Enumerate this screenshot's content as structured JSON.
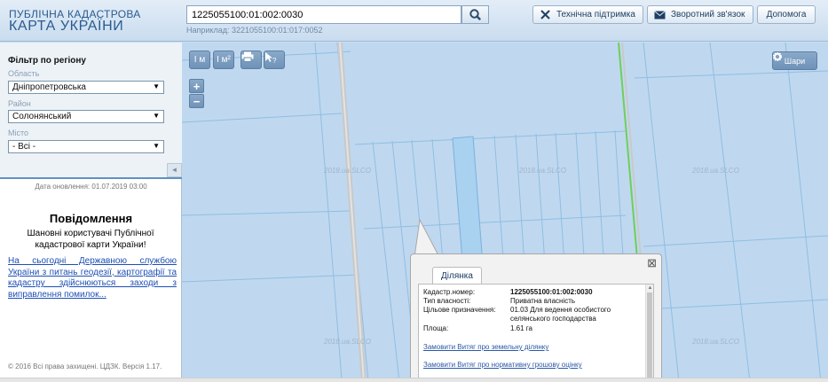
{
  "header": {
    "logo_line1": "ПУБЛІЧНА КАДАСТРОВА",
    "logo_line2": "КАРТА УКРАЇНИ",
    "search_value": "1225055100:01:002:0030",
    "search_hint": "Наприклад: 3221055100:01:017:0052",
    "search_icon": "search-icon",
    "buttons": {
      "support": "Технічна підтримка",
      "feedback": "Зворотний зв'язок",
      "help": "Допомога"
    }
  },
  "sidebar": {
    "filter_title": "Фільтр по регіону",
    "region_label": "Область",
    "region_value": "Дніпропетровська",
    "district_label": "Район",
    "district_value": "Солонянський",
    "city_label": "Місто",
    "city_value": "- Всі -",
    "collapse_icon": "◄",
    "update_date": "Дата оновлення: 01.07.2019 03:00",
    "notice_title": "Повідомлення",
    "notice_text": "Шановні користувачі Публічної кадастрової карти України!",
    "notice_link": "На сьогодні Державною службою України з питань геодезії, картографії та кадастру здійснюються заходи з виправлення помилок...",
    "copyright": "© 2016 Всі права захищені. ЦДЗК. Версія 1.17."
  },
  "map": {
    "tools": [
      "I м",
      "I м²",
      "print-icon",
      "info-cursor-icon"
    ],
    "zoom_in": "+",
    "zoom_out": "−",
    "layers_label": "Шари",
    "watermark": "2018.ua.SLCO"
  },
  "popup": {
    "tab": "Ділянка",
    "rows": [
      {
        "key": "Кадастр.номер:",
        "value": "1225055100:01:002:0030",
        "bold": true
      },
      {
        "key": "Тип власності:",
        "value": "Приватна власність"
      },
      {
        "key": "Цільове призначення:",
        "value": "01.03 Для ведення особистого селянського господарства"
      },
      {
        "key": "Площа:",
        "value": "1.61 га"
      }
    ],
    "link1": "Замовити Витяг про земельну ділянку",
    "link2": "Замовити Витяг про нормативну грошову оцінку"
  },
  "colors": {
    "map_bg": "#bfd8ef",
    "parcel_line": "#8fbde4",
    "selected_parcel": "#a9d2f0",
    "road": "#c9c9c9",
    "green_line": "#6fcf5a"
  }
}
